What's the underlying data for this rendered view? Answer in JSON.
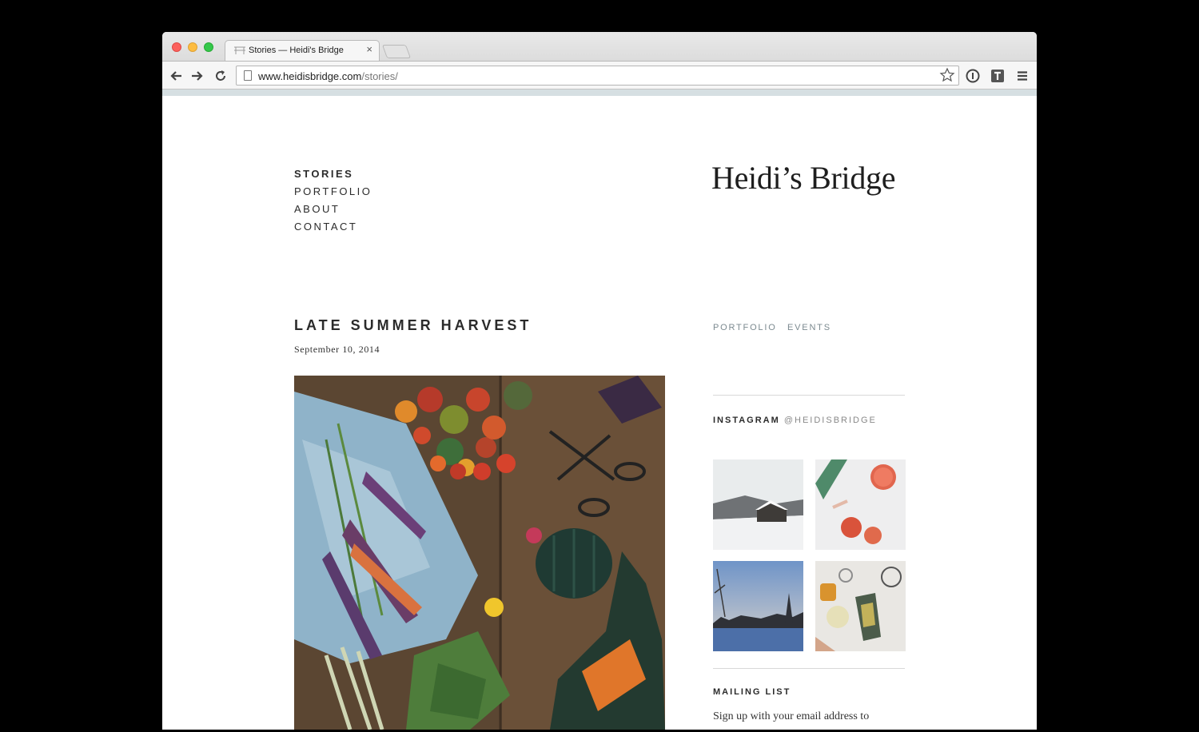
{
  "browser": {
    "tab_title": "Stories — Heidi's Bridge",
    "tab_close": "×",
    "url_host": "www.heidisbridge.com",
    "url_path": "/stories/"
  },
  "site": {
    "logo": "Heidi’s Bridge",
    "nav": [
      {
        "label": "STORIES",
        "active": true
      },
      {
        "label": "PORTFOLIO"
      },
      {
        "label": "ABOUT"
      },
      {
        "label": "CONTACT"
      }
    ]
  },
  "post": {
    "title": "LATE SUMMER HARVEST",
    "date": "September 10, 2014",
    "image": "harvest-vegetables-photo"
  },
  "sidebar": {
    "categories": [
      "PORTFOLIO",
      "EVENTS"
    ],
    "instagram_label": "INSTAGRAM",
    "instagram_handle": "@HEIDISBRIDGE",
    "thumbnails": [
      "snowy-barn-photo",
      "grapefruit-drink-photo",
      "winter-sunset-photo",
      "tea-table-photo"
    ],
    "mailing_list_heading": "MAILING LIST",
    "mailing_list_text": "Sign up with your email address to"
  },
  "colors": {
    "accent_gray": "#7c8a90",
    "text_dark": "#2b2b2b"
  }
}
